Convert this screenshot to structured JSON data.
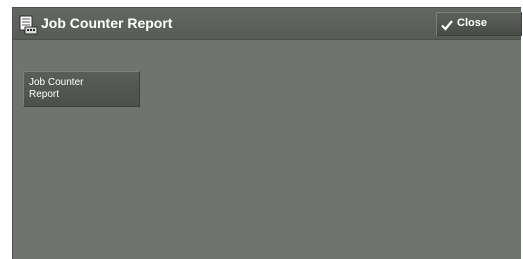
{
  "header": {
    "title": "Job Counter Report",
    "icon": "report-printer-icon",
    "close_label": "Close",
    "close_icon": "checkmark-icon"
  },
  "main": {
    "buttons": [
      {
        "label": "Job Counter Report"
      }
    ]
  },
  "colors": {
    "panel_background": "#6f756e",
    "title_bar": "#5b615a",
    "button_face": "#525851",
    "text": "#ffffff"
  }
}
